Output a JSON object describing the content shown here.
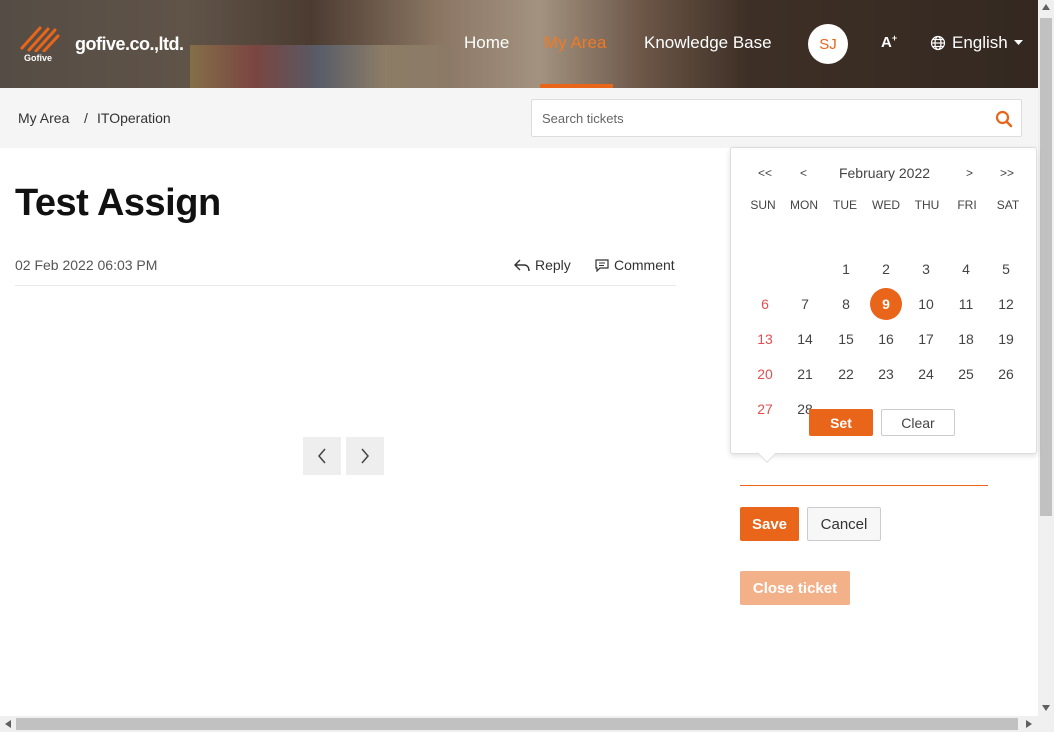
{
  "header": {
    "logo_text": "Gofive",
    "brand": "gofive.co.,ltd.",
    "nav": [
      {
        "label": "Home",
        "active": false
      },
      {
        "label": "My Area",
        "active": true
      },
      {
        "label": "Knowledge Base",
        "active": false
      }
    ],
    "avatar_initials": "SJ",
    "font_size_icon": "A",
    "language": "English"
  },
  "breadcrumb": {
    "items": [
      "My Area",
      "ITOperation"
    ],
    "separator": "/"
  },
  "search": {
    "placeholder": "Search tickets",
    "value": ""
  },
  "ticket": {
    "title": "Test Assign",
    "date": "02 Feb 2022 06:03 PM",
    "reply_label": "Reply",
    "comment_label": "Comment"
  },
  "datepicker": {
    "month_label": "February 2022",
    "prev_year": "<<",
    "prev_month": "<",
    "next_month": ">",
    "next_year": ">>",
    "weekdays": [
      "SUN",
      "MON",
      "TUE",
      "WED",
      "THU",
      "FRI",
      "SAT"
    ],
    "first_weekday_index": 2,
    "days_in_month": 28,
    "selected_day": 9,
    "set_label": "Set",
    "clear_label": "Clear"
  },
  "actions": {
    "save_label": "Save",
    "cancel_label": "Cancel",
    "close_ticket_label": "Close ticket"
  },
  "colors": {
    "accent": "#e8651a",
    "sunday": "#e05050",
    "disabled": "#f3b18a"
  }
}
